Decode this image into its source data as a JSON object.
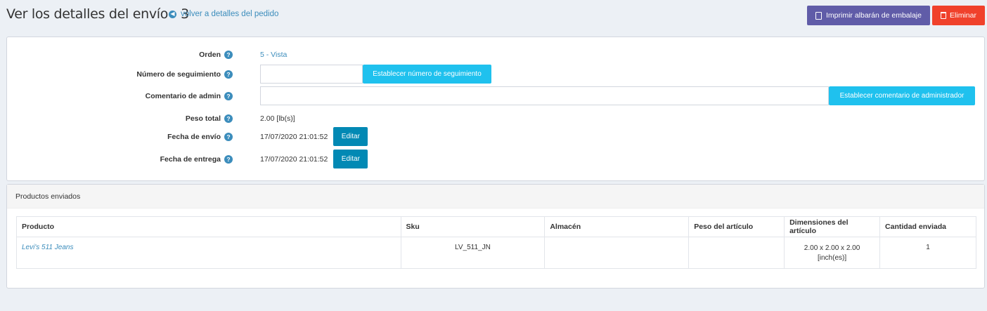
{
  "header": {
    "title": "Ver los detalles del envío - 3",
    "back_link": "volver a detalles del pedido",
    "print_button": "Imprimir albarán de embalaje",
    "delete_button": "Eliminar"
  },
  "form": {
    "order": {
      "label": "Orden",
      "value": "5 - Vista"
    },
    "tracking": {
      "label": "Número de seguimiento",
      "value": "",
      "button": "Establecer número de seguimiento"
    },
    "admin_comment": {
      "label": "Comentario de admin",
      "value": "",
      "button": "Establecer comentario de administrador"
    },
    "total_weight": {
      "label": "Peso total",
      "value": "2.00 [lb(s)]"
    },
    "ship_date": {
      "label": "Fecha de envío",
      "value": "17/07/2020 21:01:52",
      "button": "Editar"
    },
    "delivery_date": {
      "label": "Fecha de entrega",
      "value": "17/07/2020 21:01:52",
      "button": "Editar"
    }
  },
  "products": {
    "heading": "Productos enviados",
    "columns": [
      "Producto",
      "Sku",
      "Almacén",
      "Peso del artículo",
      "Dimensiones del artículo",
      "Cantidad enviada"
    ],
    "rows": [
      {
        "product": "Levi's 511 Jeans",
        "sku": "LV_511_JN",
        "warehouse": "",
        "weight": "",
        "dimensions_line1": "2.00 x 2.00 x 2.00",
        "dimensions_line2": "[inch(es)]",
        "quantity": "1"
      }
    ]
  },
  "colors": {
    "background": "#ecf0f5",
    "link": "#3c8dbc",
    "print_button": "#605ca8",
    "delete_button": "#f0412b",
    "info_button": "#1fc1ee",
    "edit_button": "#0289b4"
  },
  "icons": {
    "back": "circle-arrow-left-icon",
    "print": "file-pdf-icon",
    "delete": "trash-icon",
    "help": "question-circle-icon"
  }
}
